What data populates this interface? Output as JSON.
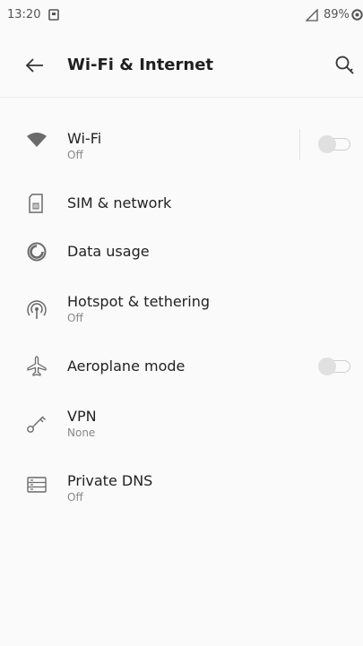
{
  "status_bar": {
    "time": "13:20",
    "battery": "89%"
  },
  "header": {
    "title": "Wi-Fi & Internet",
    "back_icon": "arrow-left-icon",
    "search_icon": "search-icon"
  },
  "items": [
    {
      "label": "Wi-Fi",
      "sub": "Off",
      "icon": "wifi-icon",
      "toggle": "off"
    },
    {
      "label": "SIM & network",
      "icon": "sim-card-icon"
    },
    {
      "label": "Data usage",
      "icon": "data-usage-icon"
    },
    {
      "label": "Hotspot & tethering",
      "sub": "Off",
      "icon": "hotspot-icon"
    },
    {
      "label": "Aeroplane mode",
      "icon": "airplane-icon",
      "toggle": "off"
    },
    {
      "label": "VPN",
      "sub": "None",
      "icon": "vpn-key-icon"
    },
    {
      "label": "Private DNS",
      "sub": "Off",
      "icon": "private-dns-icon"
    }
  ],
  "colors": {
    "background": "#fafafa",
    "icon": "#6b6b6b",
    "text": "#222222",
    "subtext": "#888888"
  }
}
